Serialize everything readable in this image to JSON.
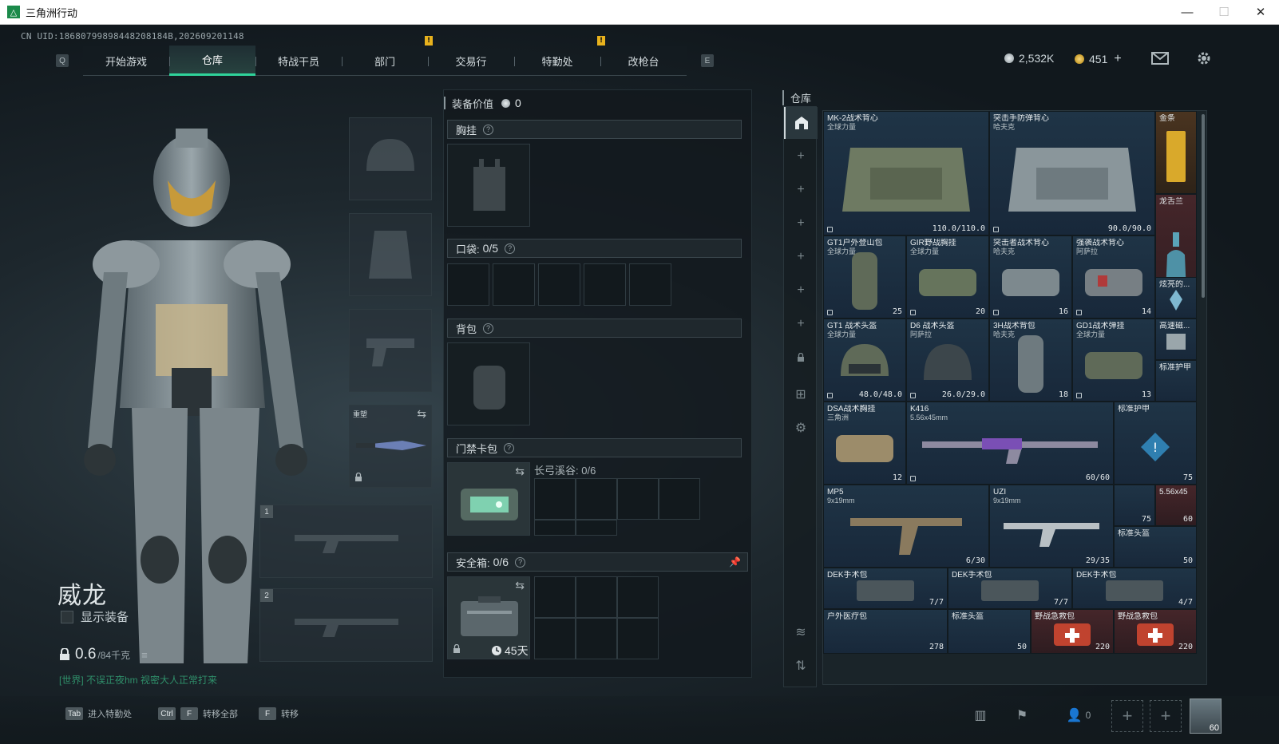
{
  "window": {
    "title": "三角洲行动",
    "minimize": "—",
    "maximize": "☐",
    "close": "✕"
  },
  "uid": "CN UID:18680799898448208184B,202609201148",
  "nav": {
    "key_left": "Q",
    "key_right": "E",
    "tabs": [
      {
        "label": "开始游戏"
      },
      {
        "label": "仓库"
      },
      {
        "label": "特战干员"
      },
      {
        "label": "部门"
      },
      {
        "label": "交易行"
      },
      {
        "label": "特勤处"
      },
      {
        "label": "改枪台"
      }
    ],
    "active_tab": "仓库",
    "notice": "!"
  },
  "currency": {
    "silver": "2,532K",
    "gold": "451",
    "add": "+"
  },
  "character": {
    "name": "威龙",
    "show_equipment": "显示装备",
    "weight_value": "0.6",
    "weight_unit": "/84千克",
    "chat": "[世界] 不误正夜hm 视密大人正常打来",
    "slot_labels": {
      "melee": "重塑",
      "primary_1": "1",
      "primary_2": "2"
    }
  },
  "equipment": {
    "value_label": "装备价值",
    "value": "0",
    "chest_rig": "胸挂",
    "pockets": "口袋:",
    "pockets_count": "0/5",
    "backpack": "背包",
    "keycard_pack": "门禁卡包",
    "keycard_sub": "长弓溪谷: 0/6",
    "safe_box": "安全箱:",
    "safe_box_count": "0/6",
    "safe_days": "45天",
    "help": "?"
  },
  "warehouse": {
    "title": "仓库",
    "items": [
      {
        "name": "MK-2战术背心",
        "sub": "全球力量",
        "count": "110.0/110.0",
        "tier": "blue"
      },
      {
        "name": "突击手防弹背心",
        "sub": "哈夫克",
        "count": "90.0/90.0",
        "tier": "blue"
      },
      {
        "name": "金条",
        "sub": "",
        "count": "",
        "tier": "gold"
      },
      {
        "name": "龙舌兰",
        "sub": "",
        "count": "",
        "tier": "red"
      },
      {
        "name": "GT1户外登山包",
        "sub": "全球力量",
        "count": "25",
        "tier": "blue"
      },
      {
        "name": "GIR野战胸挂",
        "sub": "全球力量",
        "count": "20",
        "tier": "blue"
      },
      {
        "name": "突击者战术背心",
        "sub": "哈夫克",
        "count": "16",
        "tier": "blue"
      },
      {
        "name": "强袭战术背心",
        "sub": "阿萨拉",
        "count": "14",
        "tier": "blue"
      },
      {
        "name": "炫亮的...",
        "sub": "",
        "count": "",
        "tier": "blue"
      },
      {
        "name": "GT1 战术头盔",
        "sub": "全球力量",
        "count": "48.0/48.0",
        "tier": "blue"
      },
      {
        "name": "D6 战术头盔",
        "sub": "阿萨拉",
        "count": "26.0/29.0",
        "tier": "blue"
      },
      {
        "name": "3H战术背包",
        "sub": "哈夫克",
        "count": "18",
        "tier": "blue"
      },
      {
        "name": "GD1战术弹挂",
        "sub": "全球力量",
        "count": "13",
        "tier": "blue"
      },
      {
        "name": "高速磁...",
        "sub": "",
        "count": "",
        "tier": "blue"
      },
      {
        "name": "标准护甲",
        "sub": "",
        "count": "",
        "tier": "blue"
      },
      {
        "name": "DSA战术胸挂",
        "sub": "三角洲",
        "count": "12",
        "tier": "blue"
      },
      {
        "name": "K416",
        "sub": "5.56x45mm",
        "count": "60/60",
        "tier": "blue"
      },
      {
        "name": "标准护甲",
        "sub": "",
        "count": "75",
        "tier": "blue"
      },
      {
        "name": "",
        "sub": "",
        "count": "75",
        "tier": "blue"
      },
      {
        "name": "MP5",
        "sub": "9x19mm",
        "count": "6/30",
        "tier": "blue"
      },
      {
        "name": "UZI",
        "sub": "9x19mm",
        "count": "29/35",
        "tier": "blue"
      },
      {
        "name": "5.56x45",
        "sub": "",
        "count": "60",
        "tier": "red"
      },
      {
        "name": "标准头盔",
        "sub": "",
        "count": "50",
        "tier": "blue"
      },
      {
        "name": "DEK手术包",
        "sub": "",
        "count": "7/7",
        "tier": "blue"
      },
      {
        "name": "DEK手术包",
        "sub": "",
        "count": "7/7",
        "tier": "blue"
      },
      {
        "name": "DEK手术包",
        "sub": "",
        "count": "4/7",
        "tier": "blue"
      },
      {
        "name": "户外医疗包",
        "sub": "",
        "count": "278",
        "tier": "blue"
      },
      {
        "name": "标准头盔",
        "sub": "",
        "count": "50",
        "tier": "blue"
      },
      {
        "name": "野战急救包",
        "sub": "",
        "count": "220",
        "tier": "red"
      },
      {
        "name": "野战急救包",
        "sub": "",
        "count": "220",
        "tier": "red"
      }
    ]
  },
  "bottom": {
    "hint_tab_key": "Tab",
    "hint_tab": "进入特勤处",
    "hint_ctrl_key": "Ctrl",
    "hint_f_key": "F",
    "hint_transfer_all": "转移全部",
    "hint_transfer": "转移",
    "friends": "0",
    "level": "60"
  }
}
